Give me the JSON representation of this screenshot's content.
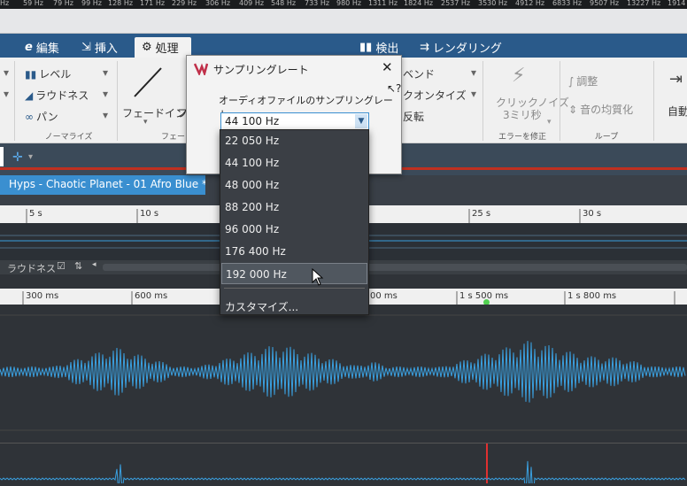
{
  "freq_bar": [
    "Hz",
    "59 Hz",
    "79 Hz",
    "99 Hz",
    "128 Hz",
    "171 Hz",
    "229 Hz",
    "306 Hz",
    "409 Hz",
    "548 Hz",
    "733 Hz",
    "980 Hz",
    "1311 Hz",
    "1824 Hz",
    "2537 Hz",
    "3530 Hz",
    "4912 Hz",
    "6833 Hz",
    "9507 Hz",
    "13227 Hz",
    "1914"
  ],
  "tabs": {
    "edit": "編集",
    "insert": "挿入",
    "process": "処理",
    "detect": "検出",
    "render": "レンダリング"
  },
  "ribbon": {
    "level": "レベル",
    "loudness": "ラウドネス",
    "pan": "パン",
    "normalize_group": "ノーマライズ",
    "fade_in": "フェードイン",
    "fade_out_partial": "フ",
    "fade_group": "フェード",
    "bend": "ベンド",
    "quantize": "クオンタイズ",
    "reverse": "反転",
    "click_noise": "クリックノイズ",
    "click_sub": "3ミリ秒",
    "error_group": "エラーを修正",
    "adjust": "調整",
    "tone_equalize": "音の均質化",
    "loop_group": "ループ",
    "auto_partial": "自動"
  },
  "file_tab": "Hyps - Chaotic Planet - 01 Afro Blue *",
  "ruler_top": [
    "5 s",
    "10 s",
    "25 s",
    "30 s"
  ],
  "ctrl_bar": {
    "loudness": "ラウドネス"
  },
  "ruler_bottom": [
    "300 ms",
    "600 ms",
    "00 ms",
    "1 s 500 ms",
    "1 s 800 ms"
  ],
  "dialog": {
    "title": "サンプリングレート",
    "label": "オーディオファイルのサンプリングレート",
    "selected": "44 100 Hz"
  },
  "dropdown": {
    "options": [
      "22 050 Hz",
      "44 100 Hz",
      "48 000 Hz",
      "88 200 Hz",
      "96 000 Hz",
      "176 400 Hz",
      "192 000 Hz"
    ],
    "customize": "カスタマイズ..."
  },
  "colors": {
    "accent": "#2a5a8a",
    "waveform": "#3aa0e0",
    "marker": "#e03030"
  }
}
